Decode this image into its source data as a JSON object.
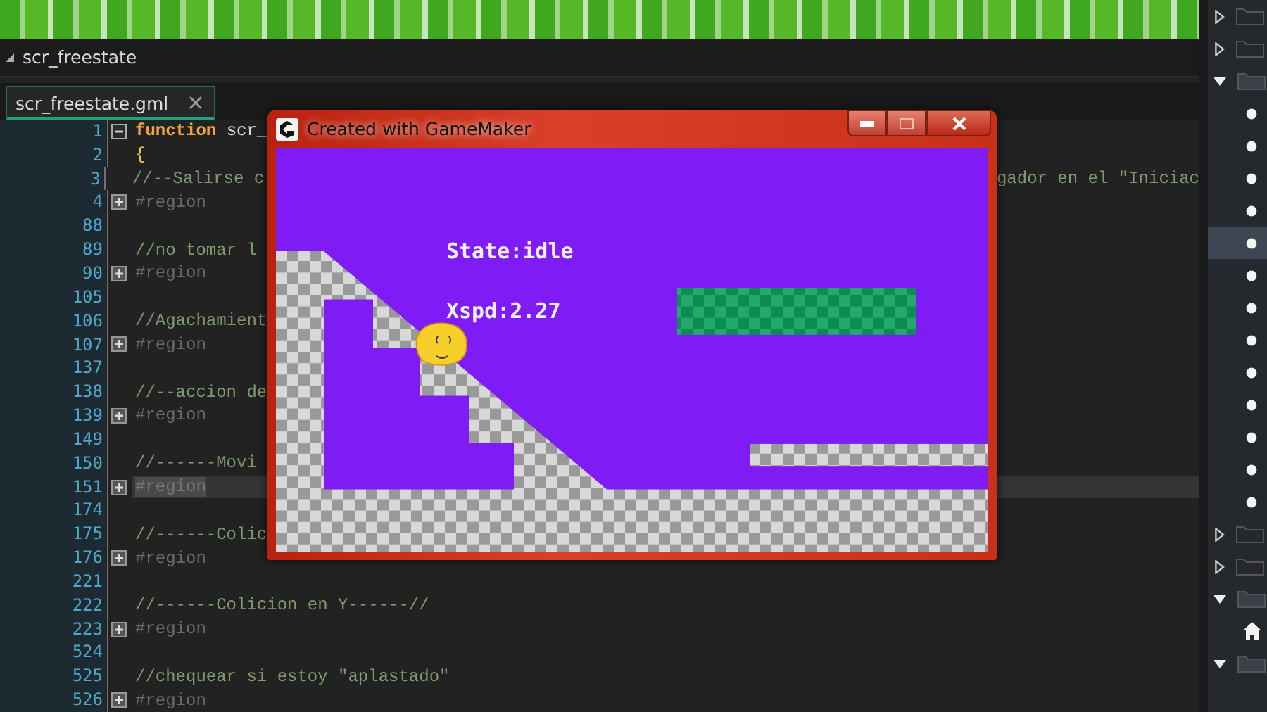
{
  "header": {
    "title": "scr_freestate"
  },
  "tabs": [
    {
      "label": "scr_freestate.gml",
      "selected": true
    }
  ],
  "editor": {
    "lines": [
      {
        "num": "1",
        "kind": "function",
        "keyword": "function",
        "text": "scr_",
        "collapsed": false,
        "highlighted": false
      },
      {
        "num": "2",
        "kind": "brace",
        "text": "{",
        "highlighted": false
      },
      {
        "num": "3",
        "kind": "comment",
        "text": "//--Salirse c",
        "text_right": "gador en el \"Iniciac",
        "highlighted": false
      },
      {
        "num": "4",
        "kind": "region",
        "text": "#region",
        "collapsed": true,
        "highlighted": false
      },
      {
        "num": "88",
        "kind": "blank",
        "highlighted": false
      },
      {
        "num": "89",
        "kind": "comment",
        "text": "//no tomar l",
        "highlighted": false
      },
      {
        "num": "90",
        "kind": "region",
        "text": "#region",
        "collapsed": true,
        "highlighted": false
      },
      {
        "num": "105",
        "kind": "blank",
        "highlighted": false
      },
      {
        "num": "106",
        "kind": "comment",
        "text": "//Agachamient",
        "highlighted": false
      },
      {
        "num": "107",
        "kind": "region",
        "text": "#region",
        "collapsed": true,
        "highlighted": false
      },
      {
        "num": "137",
        "kind": "blank",
        "highlighted": false
      },
      {
        "num": "138",
        "kind": "comment",
        "text": "//--accion de",
        "highlighted": false
      },
      {
        "num": "139",
        "kind": "region",
        "text": "#region",
        "collapsed": true,
        "highlighted": false
      },
      {
        "num": "149",
        "kind": "blank",
        "highlighted": false
      },
      {
        "num": "150",
        "kind": "comment",
        "text": "//------Movi",
        "highlighted": false
      },
      {
        "num": "151",
        "kind": "region",
        "text": "#region",
        "collapsed": true,
        "highlighted": true
      },
      {
        "num": "174",
        "kind": "blank",
        "highlighted": false
      },
      {
        "num": "175",
        "kind": "comment",
        "text": "//------Colic",
        "highlighted": false
      },
      {
        "num": "176",
        "kind": "region",
        "text": "#region",
        "collapsed": true,
        "highlighted": false
      },
      {
        "num": "221",
        "kind": "blank",
        "highlighted": false
      },
      {
        "num": "222",
        "kind": "comment",
        "text": "//------Colicion en Y------//",
        "highlighted": false
      },
      {
        "num": "223",
        "kind": "region",
        "text": "#region",
        "collapsed": true,
        "highlighted": false
      },
      {
        "num": "524",
        "kind": "blank",
        "highlighted": false
      },
      {
        "num": "525",
        "kind": "comment",
        "text": "//chequear si estoy \"aplastado\"",
        "highlighted": false
      },
      {
        "num": "526",
        "kind": "region",
        "text": "#region",
        "collapsed": true,
        "highlighted": false
      }
    ]
  },
  "game_window": {
    "title": "Created with GameMaker",
    "hud": [
      "State:idle",
      "Xspd:2.27"
    ]
  },
  "resource_tree": [
    {
      "kind": "folder",
      "expanded": false
    },
    {
      "kind": "folder",
      "expanded": false
    },
    {
      "kind": "folder",
      "expanded": true
    },
    {
      "kind": "leaf",
      "selected": false
    },
    {
      "kind": "leaf",
      "selected": false
    },
    {
      "kind": "leaf",
      "selected": false
    },
    {
      "kind": "leaf",
      "selected": false
    },
    {
      "kind": "leaf",
      "selected": true
    },
    {
      "kind": "leaf",
      "selected": false
    },
    {
      "kind": "leaf",
      "selected": false
    },
    {
      "kind": "leaf",
      "selected": false
    },
    {
      "kind": "leaf",
      "selected": false
    },
    {
      "kind": "leaf",
      "selected": false
    },
    {
      "kind": "leaf",
      "selected": false
    },
    {
      "kind": "leaf",
      "selected": false
    },
    {
      "kind": "leaf",
      "selected": false
    },
    {
      "kind": "folder",
      "expanded": false
    },
    {
      "kind": "folder",
      "expanded": false
    },
    {
      "kind": "folder",
      "expanded": true
    },
    {
      "kind": "home",
      "selected": false
    },
    {
      "kind": "folder",
      "expanded": true
    }
  ]
}
